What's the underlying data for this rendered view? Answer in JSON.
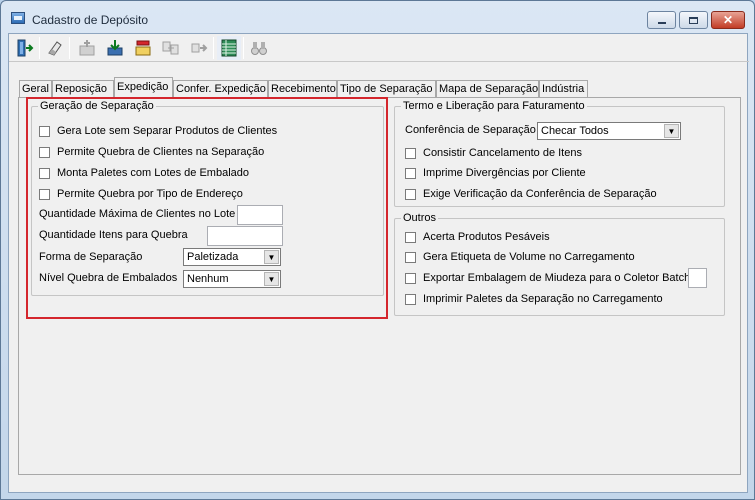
{
  "window": {
    "title": "Cadastro de Depósito",
    "close_glyph": "✕"
  },
  "toolbar": {
    "buttons": [
      "exit-icon",
      "eraser-icon",
      "add-icon",
      "save-icon",
      "delete-icon",
      "open-icon",
      "copy-icon",
      "arrow-icon",
      "grid-icon",
      "binoculars-icon"
    ]
  },
  "tabs": [
    "Geral",
    "Reposição",
    "Expedição",
    "Confer. Expedição",
    "Recebimento",
    "Tipo de Separação",
    "Mapa de Separação",
    "Indústria"
  ],
  "active_tab": "Expedição",
  "geracao": {
    "title": "Geração de Separação",
    "checks": [
      "Gera Lote sem Separar Produtos de Clientes",
      "Permite Quebra de Clientes na Separação",
      "Monta Paletes com Lotes de Embalado",
      "Permite Quebra por Tipo de Endereço"
    ],
    "qtd_max_clientes_label": "Quantidade Máxima de Clientes no Lote",
    "qtd_max_clientes_value": "",
    "qtd_itens_quebra_label": "Quantidade Itens para Quebra",
    "qtd_itens_quebra_value": "",
    "forma_label": "Forma de Separação",
    "forma_value": "Paletizada",
    "nivel_label": "Nível Quebra de Embalados",
    "nivel_value": "Nenhum"
  },
  "termo": {
    "title": "Termo e Liberação para Faturamento",
    "conferencia_label": "Conferência de Separação",
    "conferencia_value": "Checar Todos",
    "checks": [
      "Consistir Cancelamento de Itens",
      "Imprime Divergências por Cliente",
      "Exige Verificação da Conferência de Separação"
    ]
  },
  "outros": {
    "title": "Outros",
    "checks": [
      "Acerta Produtos Pesáveis",
      "Gera Etiqueta de Volume no Carregamento",
      "Exportar Embalagem de Miudeza para o Coletor Batch",
      "Imprimir Paletes da Separação no Carregamento"
    ],
    "exportar_value": ""
  },
  "colors": {
    "highlight": "#d4262d",
    "dialog_bg": "#f0f0f0"
  }
}
